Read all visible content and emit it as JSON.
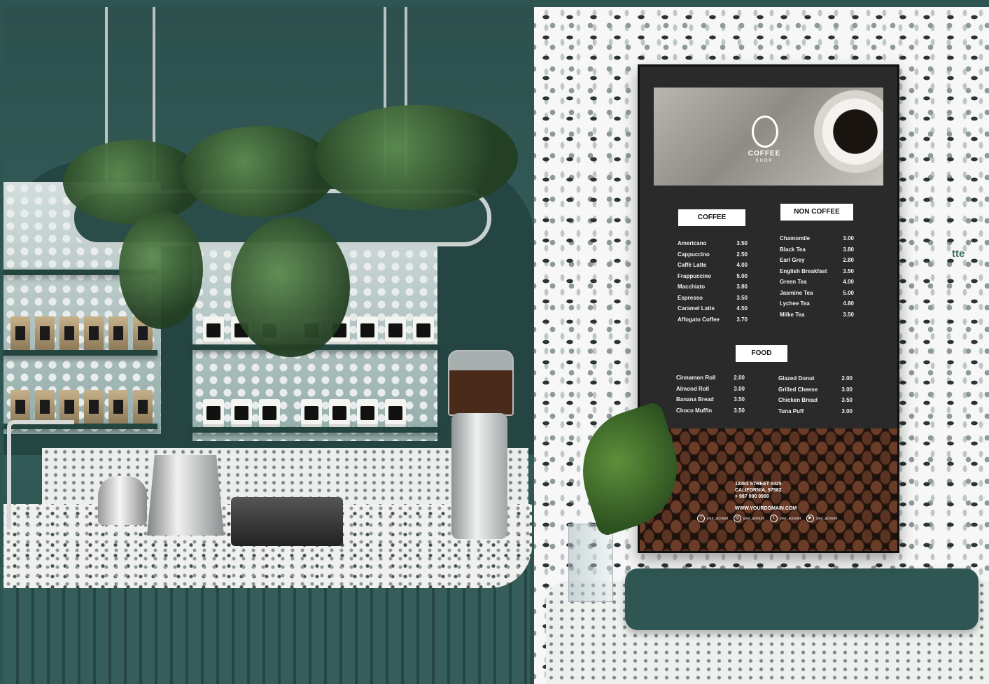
{
  "poster": {
    "brand": {
      "name": "COFFEE",
      "sub": "SHOP"
    },
    "sections": {
      "coffee": {
        "title": "COFFEE",
        "items": [
          {
            "name": "Americano",
            "price": "3.50"
          },
          {
            "name": "Cappuccino",
            "price": "2.50"
          },
          {
            "name": "Caffè Latte",
            "price": "4.00"
          },
          {
            "name": "Frappuccino",
            "price": "5.00"
          },
          {
            "name": "Macchiato",
            "price": "3.80"
          },
          {
            "name": "Espresso",
            "price": "3.50"
          },
          {
            "name": "Caramel Latte",
            "price": "4.50"
          },
          {
            "name": "Affogato Coffee",
            "price": "3.70"
          }
        ]
      },
      "non_coffee": {
        "title": "NON COFFEE",
        "items": [
          {
            "name": "Chamomile",
            "price": "3.00"
          },
          {
            "name": "Black Tea",
            "price": "3.80"
          },
          {
            "name": "Earl Grey",
            "price": "2.80"
          },
          {
            "name": "English Breakfast",
            "price": "3.50"
          },
          {
            "name": "Green Tea",
            "price": "4.00"
          },
          {
            "name": "Jasmine Tea",
            "price": "5.00"
          },
          {
            "name": "Lychee Tea",
            "price": "4.80"
          },
          {
            "name": "Milke Tea",
            "price": "3.50"
          }
        ]
      },
      "food": {
        "title": "FOOD",
        "left": [
          {
            "name": "Cinnamon Roll",
            "price": "2.00"
          },
          {
            "name": "Almond Roll",
            "price": "3.00"
          },
          {
            "name": "Banana Bread",
            "price": "3.50"
          },
          {
            "name": "Choco Muffin",
            "price": "3.50"
          }
        ],
        "right": [
          {
            "name": "Glazed Donut",
            "price": "2.00"
          },
          {
            "name": "Grilled Cheese",
            "price": "3.00"
          },
          {
            "name": "Chicken Bread",
            "price": "3.50"
          },
          {
            "name": "Tuna Puff",
            "price": "3.00"
          }
        ]
      }
    },
    "contact": {
      "street": "12383 STREET 5425",
      "city": "CALIFORNIA, 97982",
      "phone": "+ 987 990 0980",
      "website": "WWW.YOURDOMAIN.COM"
    },
    "socials": [
      {
        "icon": "facebook-icon",
        "glyph": "f",
        "handle": "your_account"
      },
      {
        "icon": "instagram-icon",
        "glyph": "◎",
        "handle": "your_account"
      },
      {
        "icon": "twitter-icon",
        "glyph": "t",
        "handle": "your_account"
      },
      {
        "icon": "youtube-icon",
        "glyph": "▶",
        "handle": "your_account"
      }
    ]
  },
  "wall_sign": "tte",
  "colors": {
    "wall_green": "#2f5552",
    "poster_bg": "#2a2a2b",
    "label_bg": "#ffffff"
  }
}
